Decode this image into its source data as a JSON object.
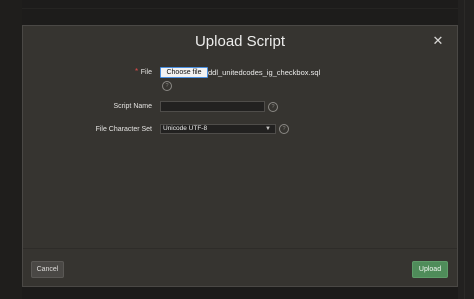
{
  "dialog": {
    "title": "Upload Script",
    "close_icon": "close-icon"
  },
  "form": {
    "file": {
      "label": "File",
      "required": true,
      "required_marker": "*",
      "button_label": "Choose file",
      "file_name": "ddl_unitedcodes_ig_checkbox.sql"
    },
    "script_name": {
      "label": "Script Name",
      "value": ""
    },
    "charset": {
      "label": "File Character Set",
      "selected": "Unicode UTF-8"
    },
    "help_icon": "help-icon",
    "help_glyph": "?"
  },
  "footer": {
    "cancel_label": "Cancel",
    "upload_label": "Upload"
  },
  "colors": {
    "dialog_bg": "#363430",
    "primary_button": "#4f8c5a",
    "required": "#e24b4b"
  }
}
